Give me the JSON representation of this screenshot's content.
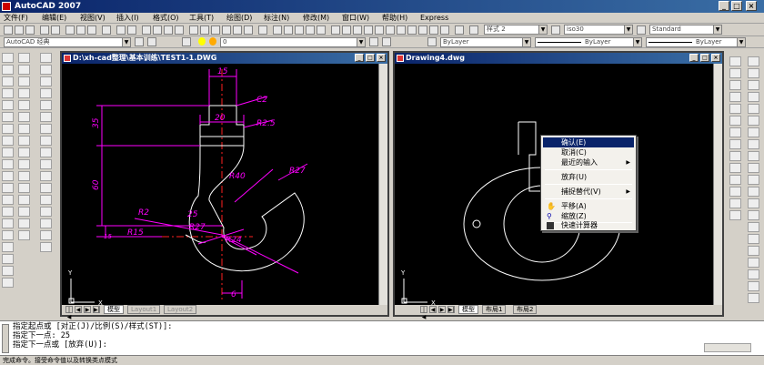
{
  "app": {
    "title": "AutoCAD 2007"
  },
  "menu": [
    "文件(F)",
    "编辑(E)",
    "视图(V)",
    "插入(I)",
    "格式(O)",
    "工具(T)",
    "绘图(D)",
    "标注(N)",
    "修改(M)",
    "窗口(W)",
    "帮助(H)",
    "Express"
  ],
  "toolbar": {
    "workspace": "AutoCAD 经典",
    "text_style": "样式 2",
    "dim_style": "iso30",
    "table_style": "Standard",
    "layer": "0",
    "color": "ByLayer",
    "linetype": "ByLayer",
    "lineweight": "ByLayer"
  },
  "left_window": {
    "title": "D:\\xh-cad整理\\基本训练\\TEST1-1.DWG",
    "tabs": [
      "模型",
      "Layout1",
      "Layout2"
    ],
    "dimensions": [
      "15",
      "C2",
      "20",
      "R2.5",
      "35",
      "R40",
      "R27",
      "60",
      "25",
      "R27",
      "R2",
      "R15",
      "R24",
      "15",
      "6"
    ]
  },
  "right_window": {
    "title": "Drawing4.dwg",
    "tabs": [
      "模型",
      "布局1",
      "布局2"
    ]
  },
  "context_menu": {
    "items": [
      "确认(E)",
      "取消(C)",
      "最近的输入",
      "放弃(U)",
      "捕捉替代(V)",
      "平移(A)",
      "缩放(Z)",
      "快速计算器"
    ]
  },
  "command": {
    "lines": [
      "指定起点或 [对正(J)/比例(S)/样式(ST)]:",
      "指定下一点: 25",
      "指定下一点或 [放弃(U)]:"
    ]
  },
  "status": {
    "text": "完成命令。接受命令值以及转换类点模式"
  },
  "colors": {
    "cad_bg": "#000000",
    "dimension": "#ff00ff",
    "centerline": "#ff0000",
    "geometry": "#ffffff",
    "title_active": "#0a246a"
  }
}
